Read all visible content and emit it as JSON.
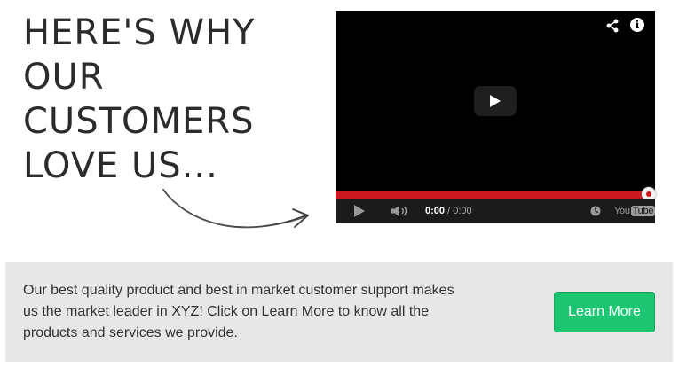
{
  "hero": {
    "headline_lines": [
      "HERE'S WHY",
      "OUR",
      "CUSTOMERS",
      "LOVE US..."
    ]
  },
  "video": {
    "info_symbol": "i",
    "time_current": "0:00",
    "time_separator": " / ",
    "time_total": "0:00",
    "progress_fraction": 1.0,
    "brand_left": "You",
    "brand_right": "Tube",
    "accent_color": "#cc181e"
  },
  "icons": [
    "share-icon",
    "info-icon",
    "play-icon",
    "volume-icon",
    "clock-icon"
  ],
  "cta": {
    "text": "Our best quality product and best in market customer support makes us the market leader in XYZ! Click on Learn More to know all the products and services we provide.",
    "button_label": "Learn More",
    "button_color": "#1cc571",
    "band_color": "#e7e7e7"
  }
}
